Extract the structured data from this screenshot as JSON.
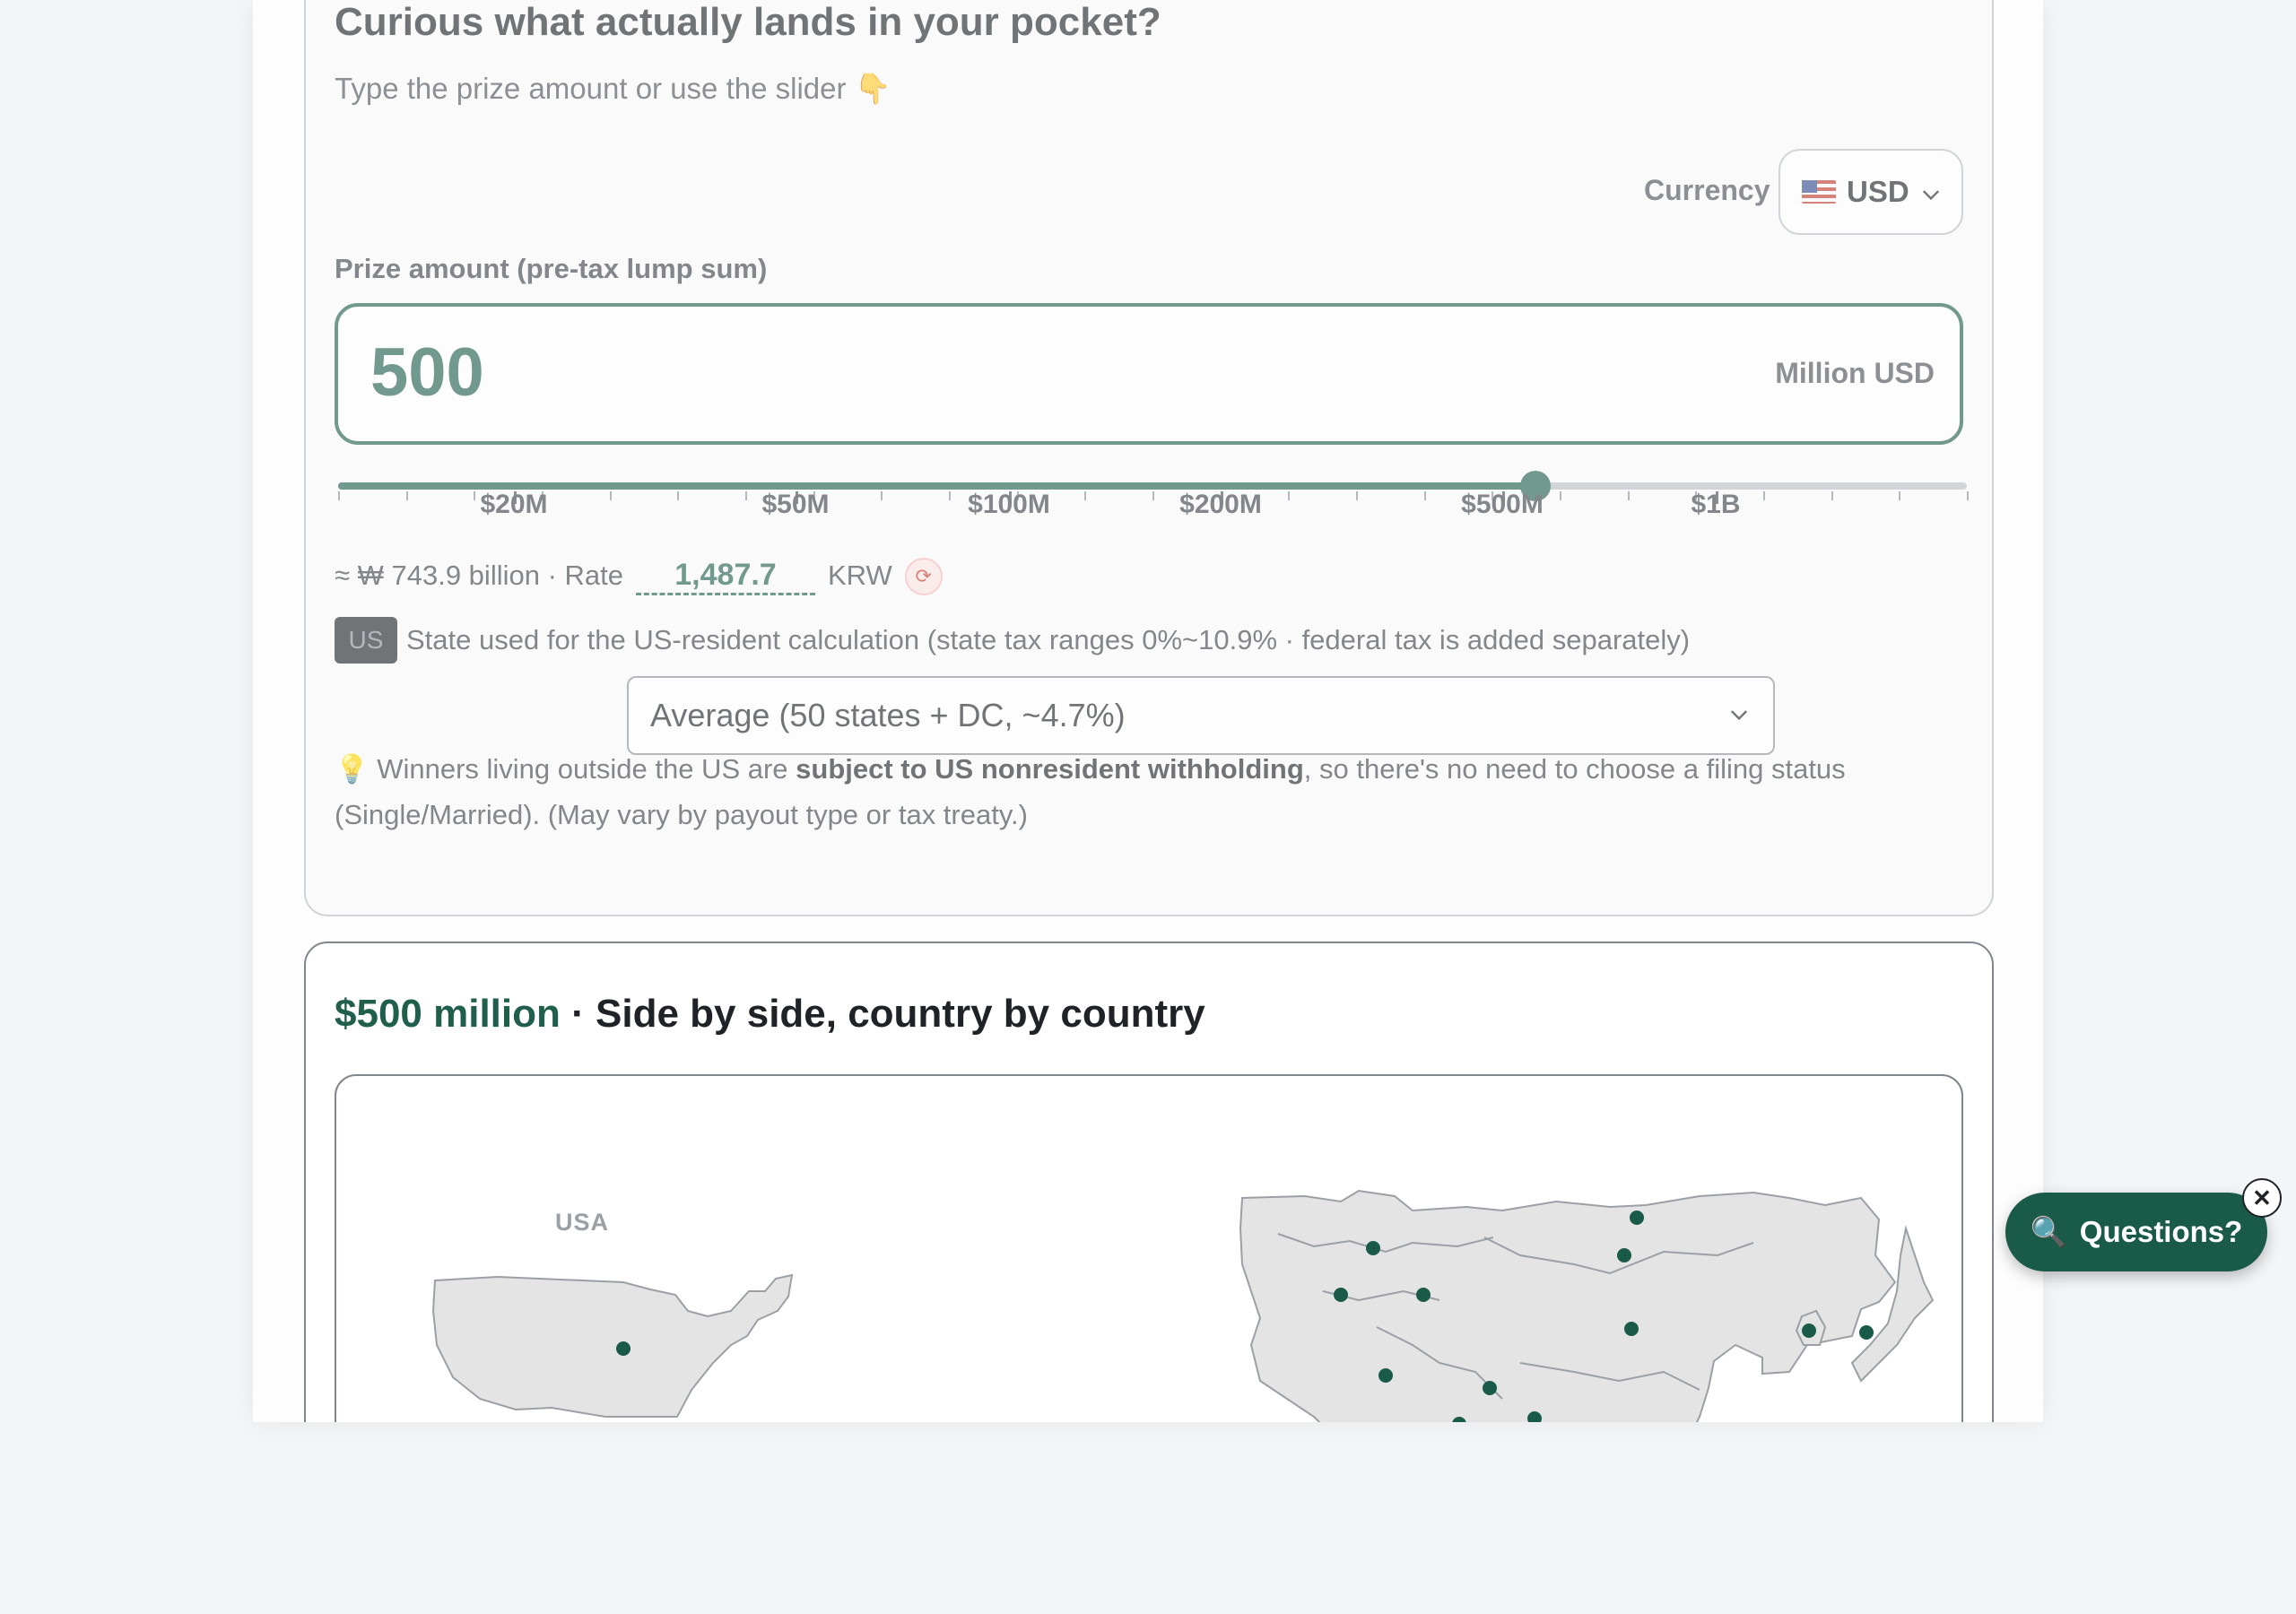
{
  "input_card": {
    "title": "Curious what actually lands in your pocket?",
    "subtitle": "Type the prize amount or use the slider 👇",
    "currency": {
      "label": "Currency",
      "selected": "USD"
    },
    "prize": {
      "label": "Prize amount (pre-tax lump sum)",
      "value": "500",
      "unit": "Million USD"
    },
    "slider": {
      "position_fraction": 0.735,
      "tick_labels": [
        "$20M",
        "$50M",
        "$100M",
        "$200M",
        "$500M",
        "$1B"
      ]
    },
    "conversion": {
      "approx": "≈ ₩ 743.9 billion · Rate",
      "rate": "1,487.7",
      "currency": "KRW"
    },
    "state": {
      "badge": "US",
      "description": "State used for the US-resident calculation (state tax ranges 0%~10.9% · federal tax is added separately)",
      "selected": "Average (50 states + DC, ~4.7%)"
    },
    "note": {
      "prefix": "💡 Winners living outside the US are ",
      "bold": "subject to US nonresident withholding",
      "suffix": ", so there's no need to choose a filing status (Single/Married). (May vary by payout type or tax treaty.)"
    }
  },
  "compare_card": {
    "amount": "$500 million",
    "separator": " · ",
    "title": "Side by side, country by country",
    "map": {
      "usa_label": "USA"
    }
  },
  "help_button": {
    "icon": "search-icon",
    "label": "Questions?",
    "close": "✕"
  },
  "colors": {
    "accent": "#1f5f4b",
    "button": "#1a5a48",
    "land": "#e4e4e4"
  }
}
